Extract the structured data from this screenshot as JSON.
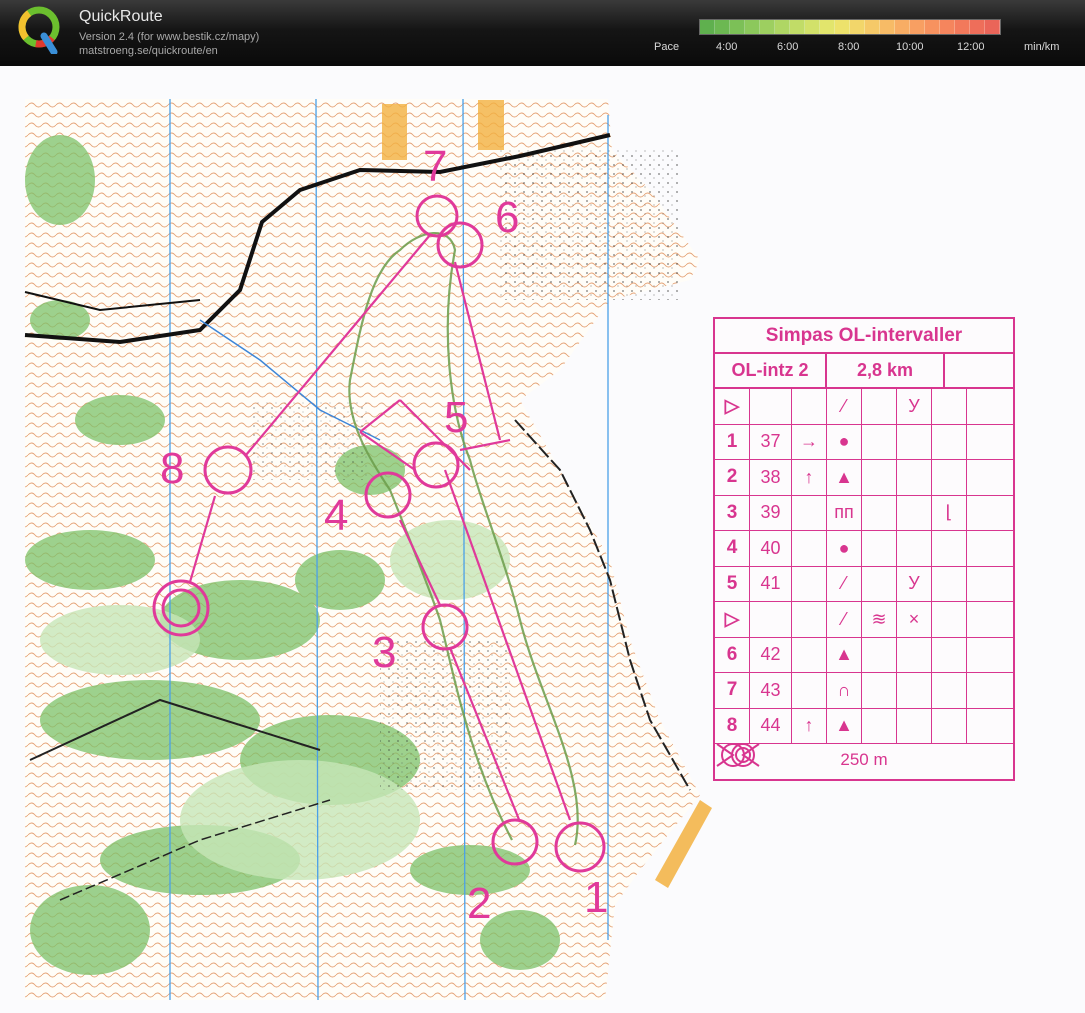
{
  "app": {
    "title": "QuickRoute",
    "version": "Version 2.4  (for www.bestik.cz/mapy)",
    "website": "matstroeng.se/quickroute/en"
  },
  "pace": {
    "label": "Pace",
    "ticks": [
      "4:00",
      "6:00",
      "8:00",
      "10:00",
      "12:00"
    ],
    "unit": "min/km",
    "colors": [
      "#5fb04e",
      "#6cb852",
      "#7cc057",
      "#8cc85c",
      "#9dcf60",
      "#afd664",
      "#c1dc67",
      "#d2e16a",
      "#e2e56c",
      "#ede26b",
      "#f2d66a",
      "#f5c968",
      "#f7bb66",
      "#f8ad64",
      "#f89f62",
      "#f7925f",
      "#f5855d",
      "#f2795b",
      "#ee6e5a",
      "#ea6559"
    ]
  },
  "map": {
    "course_color": "#e0399a",
    "control_labels": [
      "1",
      "2",
      "3",
      "4",
      "5",
      "6",
      "7",
      "8"
    ]
  },
  "description": {
    "event": "Simpas OL-intervaller",
    "course": "OL-intz 2",
    "length": "2,8 km",
    "rows": [
      {
        "num": "▷",
        "code": "",
        "c": "",
        "d": "⁄",
        "e": "",
        "f": "У",
        "g": "",
        "h": ""
      },
      {
        "num": "1",
        "code": "37",
        "c": "→",
        "d": "●",
        "e": "",
        "f": "",
        "g": "",
        "h": ""
      },
      {
        "num": "2",
        "code": "38",
        "c": "↑",
        "d": "▲",
        "e": "",
        "f": "",
        "g": "",
        "h": ""
      },
      {
        "num": "3",
        "code": "39",
        "c": "",
        "d": "ᴨᴨ",
        "e": "",
        "f": "",
        "g": "⌊",
        "h": ""
      },
      {
        "num": "4",
        "code": "40",
        "c": "",
        "d": "●",
        "e": "",
        "f": "",
        "g": "",
        "h": ""
      },
      {
        "num": "5",
        "code": "41",
        "c": "",
        "d": "⁄",
        "e": "",
        "f": "У",
        "g": "",
        "h": ""
      },
      {
        "num": "▷",
        "code": "",
        "c": "",
        "d": "⁄",
        "e": "≋",
        "f": "×",
        "g": "",
        "h": ""
      },
      {
        "num": "6",
        "code": "42",
        "c": "",
        "d": "▲",
        "e": "",
        "f": "",
        "g": "",
        "h": ""
      },
      {
        "num": "7",
        "code": "43",
        "c": "",
        "d": "∩",
        "e": "",
        "f": "",
        "g": "",
        "h": ""
      },
      {
        "num": "8",
        "code": "44",
        "c": "↑",
        "d": "▲",
        "e": "",
        "f": "",
        "g": "",
        "h": ""
      }
    ],
    "footer": "250 m"
  }
}
